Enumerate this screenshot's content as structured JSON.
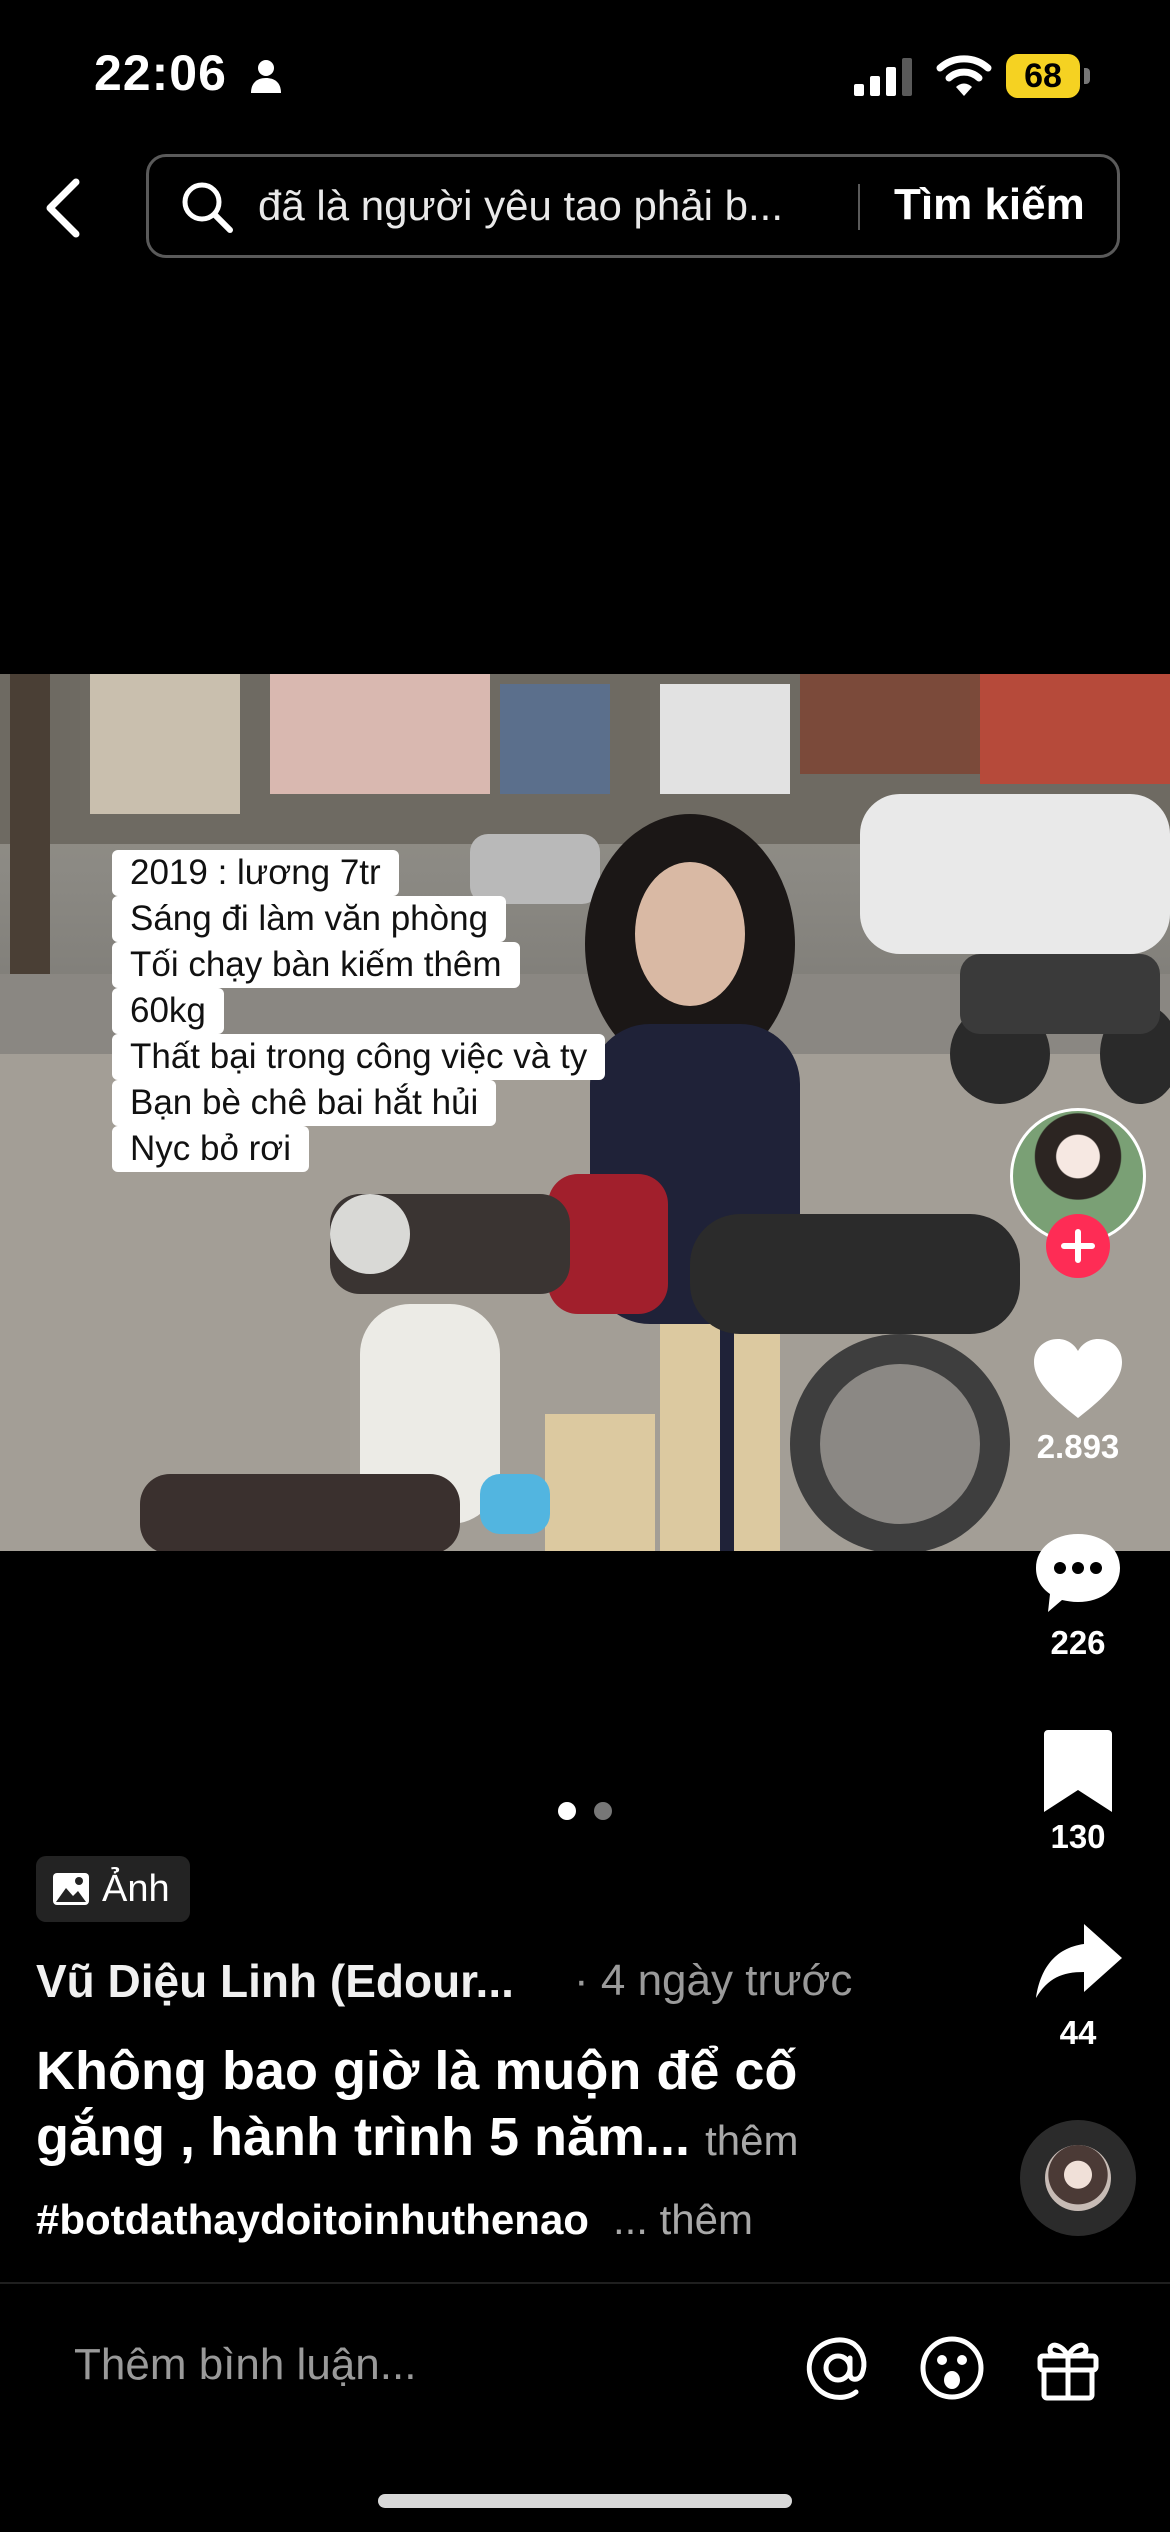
{
  "status_bar": {
    "time": "22:06",
    "battery": "68",
    "icons": [
      "person-icon",
      "signal-icon",
      "wifi-icon",
      "battery-icon"
    ]
  },
  "search": {
    "query": "đã là người yêu tao phải b...",
    "button_label": "Tìm kiếm"
  },
  "post": {
    "overlay_lines": [
      "2019 : lương 7tr",
      "Sáng đi làm văn phòng",
      "Tối chạy bàn kiếm thêm",
      "60kg",
      "Thất bại trong công việc và ty",
      "Bạn bè chê bai hắt hủi",
      "Nyc bỏ rơi"
    ],
    "photo_badge": "Ảnh",
    "author": "Vũ Diệu Linh (Edour...",
    "time_ago": "· 4 ngày trước",
    "caption": "Không bao giờ là muộn để cố gắng , hành trình 5 năm...",
    "caption_more": "thêm",
    "hashtag": "#botdathaydoitoinhuthenao",
    "hashtag_more": "... thêm",
    "pagination": {
      "total": 2,
      "current": 1
    }
  },
  "actions": {
    "likes": "2.893",
    "comments": "226",
    "saves": "130",
    "shares": "44"
  },
  "comment_bar": {
    "placeholder": "Thêm bình luận..."
  },
  "colors": {
    "accent_red": "#fe2c55",
    "battery_yellow": "#f5d222",
    "background": "#000000"
  }
}
